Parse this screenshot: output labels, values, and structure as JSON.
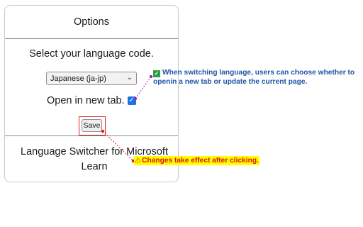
{
  "panel": {
    "title": "Options",
    "prompt": "Select your language code.",
    "language_select": {
      "selected": "Japanese (ja-jp)",
      "chevron": "⌄"
    },
    "new_tab": {
      "label": "Open in new tab.",
      "checked": true,
      "check_glyph": "✓"
    },
    "save_label": "Save",
    "footer": "Language Switcher for Microsoft Learn"
  },
  "annotations": {
    "new_tab_note": {
      "icon": "✓",
      "text": "When switching language, users can choose whether to openin a new tab or update the current page."
    },
    "save_note": {
      "icon": "⚠",
      "text": "Changes take effect after clicking."
    }
  },
  "colors": {
    "checkbox": "#1a73e8",
    "save_highlight_border": "#e02020",
    "note_blue": "#1f56a5",
    "note_red": "#e0101a",
    "note_highlight": "#ffff00",
    "arrow_purple": "#a020c0",
    "arrow_red": "#e02020"
  }
}
